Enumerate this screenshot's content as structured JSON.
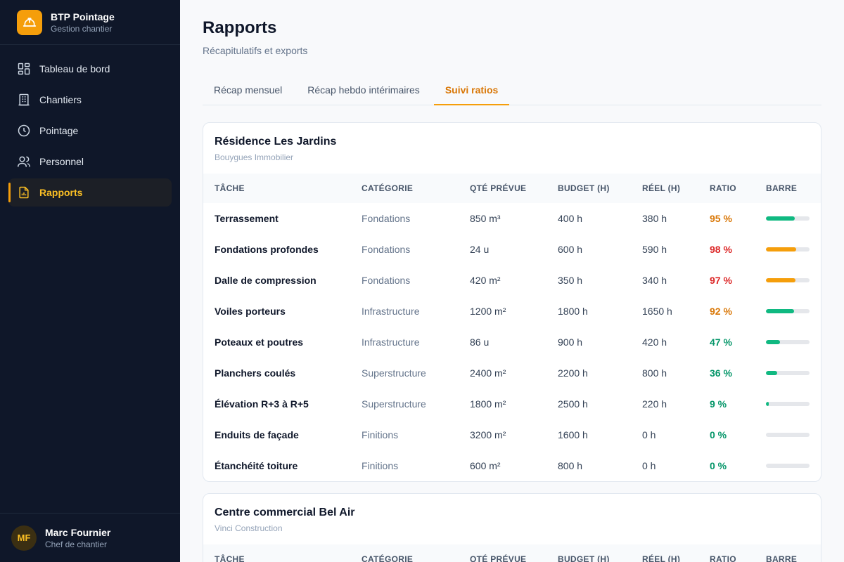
{
  "brand": {
    "title": "BTP Pointage",
    "subtitle": "Gestion chantier",
    "icon": "hard-hat-icon",
    "accent": "#f59e0b"
  },
  "nav": [
    {
      "label": "Tableau de bord",
      "icon": "dashboard-icon",
      "active": false
    },
    {
      "label": "Chantiers",
      "icon": "building-icon",
      "active": false
    },
    {
      "label": "Pointage",
      "icon": "clock-icon",
      "active": false
    },
    {
      "label": "Personnel",
      "icon": "users-icon",
      "active": false
    },
    {
      "label": "Rapports",
      "icon": "report-icon",
      "active": true
    }
  ],
  "user": {
    "initials": "MF",
    "name": "Marc Fournier",
    "role": "Chef de chantier"
  },
  "page": {
    "title": "Rapports",
    "subtitle": "Récapitulatifs et exports"
  },
  "tabs": [
    {
      "label": "Récap mensuel",
      "active": false
    },
    {
      "label": "Récap hebdo intérimaires",
      "active": false
    },
    {
      "label": "Suivi ratios",
      "active": true
    }
  ],
  "colors": {
    "green": "#10b981",
    "orange": "#f59e0b",
    "red": "#dc2626",
    "ratio_green": "#059669",
    "ratio_orange": "#d97706"
  },
  "columns": [
    "TÂCHE",
    "CATÉGORIE",
    "QTÉ PRÉVUE",
    "BUDGET (H)",
    "RÉEL (H)",
    "RATIO",
    "BARRE"
  ],
  "projects": [
    {
      "name": "Résidence Les Jardins",
      "client": "Bouygues Immobilier",
      "rows": [
        {
          "task": "Terrassement",
          "category": "Fondations",
          "qty": "850 m³",
          "budget": "400 h",
          "real": "380 h",
          "ratio": "95 %",
          "ratio_value": 95,
          "status": "orange",
          "bar_status": "green"
        },
        {
          "task": "Fondations profondes",
          "category": "Fondations",
          "qty": "24 u",
          "budget": "600 h",
          "real": "590 h",
          "ratio": "98 %",
          "ratio_value": 98,
          "status": "red",
          "bar_status": "orange"
        },
        {
          "task": "Dalle de compression",
          "category": "Fondations",
          "qty": "420 m²",
          "budget": "350 h",
          "real": "340 h",
          "ratio": "97 %",
          "ratio_value": 97,
          "status": "red",
          "bar_status": "orange"
        },
        {
          "task": "Voiles porteurs",
          "category": "Infrastructure",
          "qty": "1200 m²",
          "budget": "1800 h",
          "real": "1650 h",
          "ratio": "92 %",
          "ratio_value": 92,
          "status": "orange",
          "bar_status": "green"
        },
        {
          "task": "Poteaux et poutres",
          "category": "Infrastructure",
          "qty": "86 u",
          "budget": "900 h",
          "real": "420 h",
          "ratio": "47 %",
          "ratio_value": 47,
          "status": "green",
          "bar_status": "green"
        },
        {
          "task": "Planchers coulés",
          "category": "Superstructure",
          "qty": "2400 m²",
          "budget": "2200 h",
          "real": "800 h",
          "ratio": "36 %",
          "ratio_value": 36,
          "status": "green",
          "bar_status": "green"
        },
        {
          "task": "Élévation R+3 à R+5",
          "category": "Superstructure",
          "qty": "1800 m²",
          "budget": "2500 h",
          "real": "220 h",
          "ratio": "9 %",
          "ratio_value": 9,
          "status": "green",
          "bar_status": "green"
        },
        {
          "task": "Enduits de façade",
          "category": "Finitions",
          "qty": "3200 m²",
          "budget": "1600 h",
          "real": "0 h",
          "ratio": "0 %",
          "ratio_value": 0,
          "status": "green",
          "bar_status": "green"
        },
        {
          "task": "Étanchéité toiture",
          "category": "Finitions",
          "qty": "600 m²",
          "budget": "800 h",
          "real": "0 h",
          "ratio": "0 %",
          "ratio_value": 0,
          "status": "green",
          "bar_status": "green"
        }
      ]
    },
    {
      "name": "Centre commercial Bel Air",
      "client": "Vinci Construction",
      "rows": []
    }
  ]
}
